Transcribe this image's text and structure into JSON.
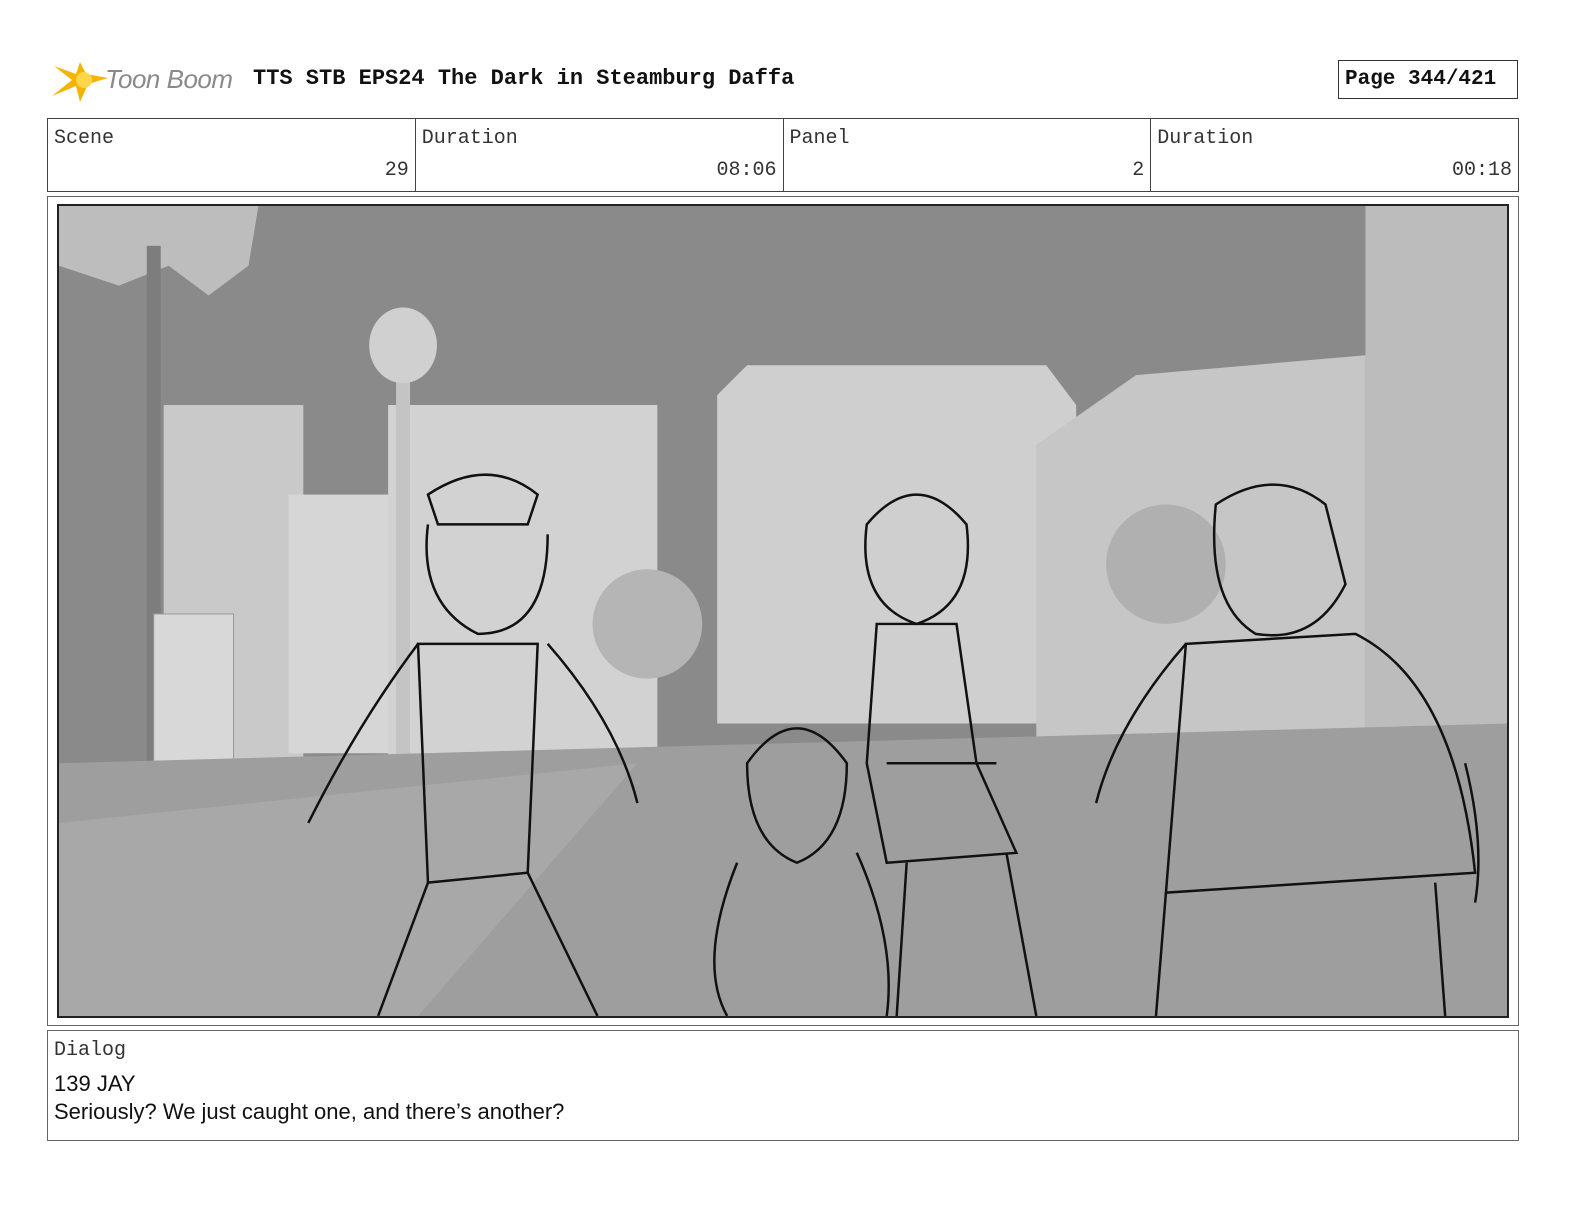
{
  "header": {
    "logo_text": "Toon Boom",
    "title": "TTS STB EPS24 The Dark in Steamburg Daffa",
    "page": "Page 344/421"
  },
  "info": {
    "scene_label": "Scene",
    "scene_value": "29",
    "scene_duration_label": "Duration",
    "scene_duration_value": "08:06",
    "panel_label": "Panel",
    "panel_value": "2",
    "panel_duration_label": "Duration",
    "panel_duration_value": "00:18"
  },
  "dialog": {
    "label": "Dialog",
    "speaker": "139 JAY",
    "line": "Seriously? We just caught one, and there’s another?"
  },
  "colors": {
    "logo_flame": "#f5b400",
    "sky": "#8c8c8c",
    "buildings": "#cfcfcf",
    "ground": "#9e9e9e",
    "sketch_line": "#111111"
  }
}
